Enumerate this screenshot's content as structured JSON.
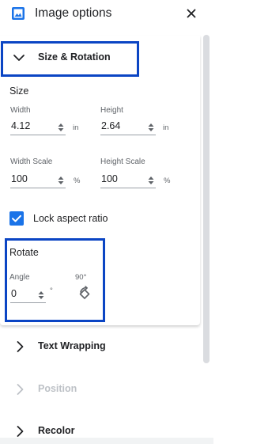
{
  "header": {
    "title": "Image options",
    "icon": "image-icon",
    "close_icon": "close-icon"
  },
  "size_rotation": {
    "label": "Size & Rotation",
    "expanded": true,
    "size": {
      "title": "Size",
      "width": {
        "label": "Width",
        "value": "4.12",
        "unit": "in"
      },
      "height": {
        "label": "Height",
        "value": "2.64",
        "unit": "in"
      },
      "width_scale": {
        "label": "Width Scale",
        "value": "100",
        "unit": "%"
      },
      "height_scale": {
        "label": "Height Scale",
        "value": "100",
        "unit": "%"
      },
      "lock_aspect": {
        "label": "Lock aspect ratio",
        "checked": true
      }
    },
    "rotate": {
      "title": "Rotate",
      "angle": {
        "label": "Angle",
        "value": "0",
        "unit": "°"
      },
      "rotate_90": {
        "label": "90°",
        "icon": "rotate-90-icon"
      }
    }
  },
  "sections": [
    {
      "label": "Text Wrapping",
      "enabled": true
    },
    {
      "label": "Position",
      "enabled": false
    },
    {
      "label": "Recolor",
      "enabled": true
    }
  ],
  "colors": {
    "accent": "#1a73e8",
    "highlight": "#0b45c4",
    "text": "#202124",
    "muted": "#5f6368"
  }
}
